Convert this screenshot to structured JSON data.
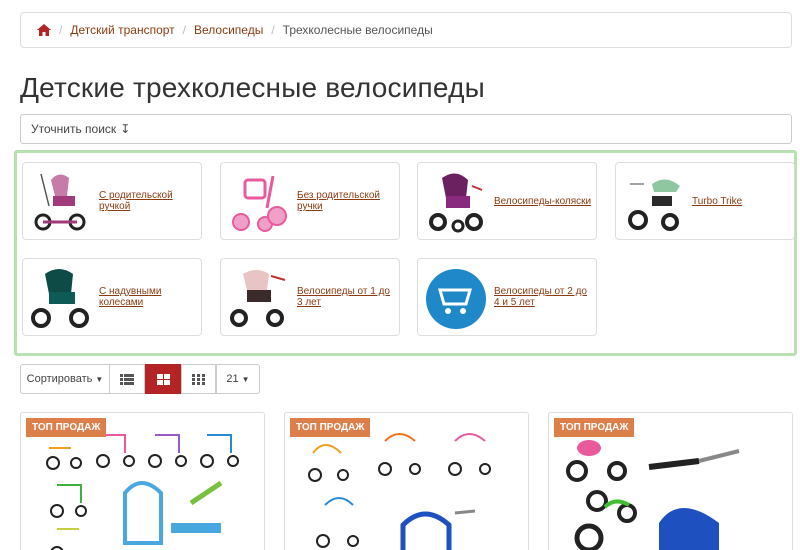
{
  "breadcrumb": {
    "home_icon": "home-icon",
    "items": [
      "Детский транспорт",
      "Велосипеды"
    ],
    "current": "Трехколесные велосипеды"
  },
  "page_title": "Детские трехколесные велосипеды",
  "refine": {
    "label": "Уточнить поиск",
    "icon": "arrow-down-icon"
  },
  "subcategories": [
    {
      "label": "С родительской ручкой",
      "icon": "tricycle-pink-handle"
    },
    {
      "label": "Без родительской ручки",
      "icon": "tricycle-pink"
    },
    {
      "label": "Велосипеды-коляски",
      "icon": "tricycle-stroller-purple"
    },
    {
      "label": "Turbo Trike",
      "icon": "tricycle-green-canopy"
    },
    {
      "label": "С надувными колесами",
      "icon": "tricycle-teal"
    },
    {
      "label": "Велосипеды от 1 до 3 лет",
      "icon": "tricycle-beige"
    },
    {
      "label": "Велосипеды от 2 до 4 и 5 лет",
      "icon": "cart-icon"
    }
  ],
  "toolbar": {
    "sort_label": "Сортировать",
    "view_list_icon": "list-view-icon",
    "view_grid_large_icon": "grid-large-icon",
    "view_grid_small_icon": "grid-small-icon",
    "per_page": "21"
  },
  "products": [
    {
      "badge": "ТОП ПРОДАЖ"
    },
    {
      "badge": "ТОП ПРОДАЖ"
    },
    {
      "badge": "ТОП ПРОДАЖ"
    }
  ],
  "colors": {
    "link": "#8a3b12",
    "accent": "#b52424",
    "badge": "#dc7f4a",
    "highlight_border": "#b8e0b0"
  }
}
